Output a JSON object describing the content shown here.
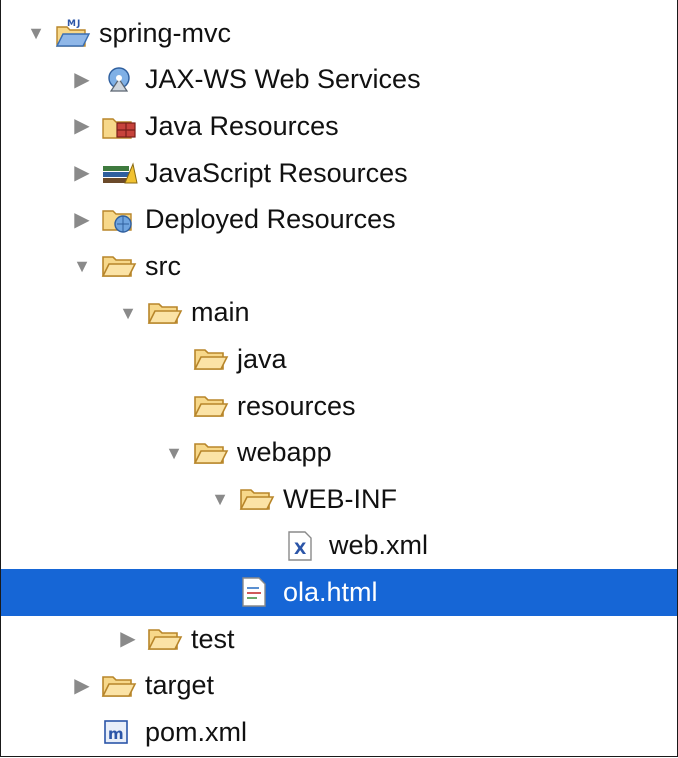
{
  "tree": {
    "nodes": [
      {
        "label": "spring-mvc",
        "icon": "maven-project-icon",
        "depth": 0,
        "expander": "expanded"
      },
      {
        "label": "JAX-WS Web Services",
        "icon": "web-services-icon",
        "depth": 1,
        "expander": "collapsed"
      },
      {
        "label": "Java Resources",
        "icon": "java-resources-icon",
        "depth": 1,
        "expander": "collapsed"
      },
      {
        "label": "JavaScript Resources",
        "icon": "javascript-resources-icon",
        "depth": 1,
        "expander": "collapsed"
      },
      {
        "label": "Deployed Resources",
        "icon": "deployed-resources-icon",
        "depth": 1,
        "expander": "collapsed"
      },
      {
        "label": "src",
        "icon": "folder-icon",
        "depth": 1,
        "expander": "expanded"
      },
      {
        "label": "main",
        "icon": "folder-icon",
        "depth": 2,
        "expander": "expanded"
      },
      {
        "label": "java",
        "icon": "folder-icon",
        "depth": 3,
        "expander": "none"
      },
      {
        "label": "resources",
        "icon": "folder-icon",
        "depth": 3,
        "expander": "none"
      },
      {
        "label": "webapp",
        "icon": "folder-icon",
        "depth": 3,
        "expander": "expanded"
      },
      {
        "label": "WEB-INF",
        "icon": "folder-icon",
        "depth": 4,
        "expander": "expanded"
      },
      {
        "label": "web.xml",
        "icon": "xml-file-icon",
        "depth": 5,
        "expander": "none"
      },
      {
        "label": "ola.html",
        "icon": "html-file-icon",
        "depth": 4,
        "expander": "none",
        "selected": true
      },
      {
        "label": "test",
        "icon": "folder-icon",
        "depth": 2,
        "expander": "collapsed"
      },
      {
        "label": "target",
        "icon": "folder-icon",
        "depth": 1,
        "expander": "collapsed"
      },
      {
        "label": "pom.xml",
        "icon": "maven-pom-icon",
        "depth": 1,
        "expander": "none"
      }
    ]
  },
  "colors": {
    "selection": "#1666d6",
    "folder": "#f5c46a",
    "expander": "#8a8a8a"
  }
}
